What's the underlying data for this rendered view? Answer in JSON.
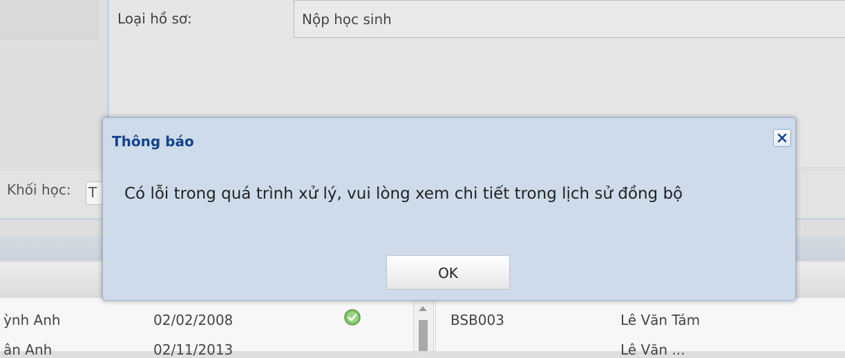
{
  "form": {
    "doc_type_label": "Loại hồ sơ:",
    "doc_type_value": "Nộp học sinh"
  },
  "filter": {
    "grade_label": "Khối học:",
    "grade_value": "T"
  },
  "left_grid": {
    "rows": [
      {
        "name": "ỳnh Anh",
        "dob": "02/02/2008",
        "status_icon": "check-circle-icon"
      },
      {
        "name": "ân Anh",
        "dob": "02/11/2013"
      }
    ]
  },
  "right_grid": {
    "rows": [
      {
        "code": "BSB003",
        "name": "Lê Văn Tám"
      },
      {
        "name": "Lê Văn ..."
      }
    ]
  },
  "dialog": {
    "title": "Thông báo",
    "message": "Có lỗi trong quá trình xử lý, vui lòng xem chi tiết trong lịch sử đồng bộ",
    "ok_label": "OK",
    "close_icon": "close-icon"
  },
  "colors": {
    "dialog_title": "#15428b",
    "dialog_bg": "#cddbea",
    "status_ok": "#6dbb4f"
  }
}
